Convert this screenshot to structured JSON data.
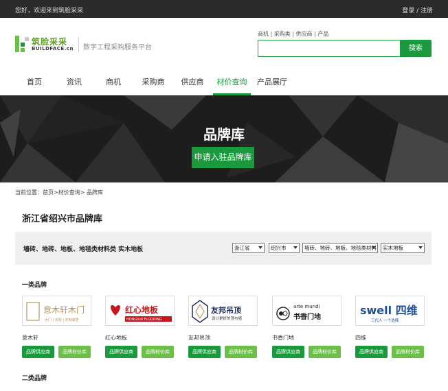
{
  "topbar": {
    "welcome": "您好，欢迎来到筑脸采采",
    "login": "登录 / 注册"
  },
  "logo": {
    "cn": "筑脸采采",
    "en": "BUILDFACE.cn",
    "slogan": "数字工程采购服务平台",
    "color": "#5a9e1e"
  },
  "search": {
    "categories": "商机 | 采购类 | 供应商 | 产品",
    "value": "",
    "button": "搜索"
  },
  "nav": {
    "items": [
      {
        "label": "首页"
      },
      {
        "label": "资讯"
      },
      {
        "label": "商机"
      },
      {
        "label": "采购商"
      },
      {
        "label": "供应商"
      },
      {
        "label": "材价查询",
        "active": true
      },
      {
        "label": "产品展厅"
      }
    ]
  },
  "hero": {
    "title": "品牌库",
    "button": "申请入驻品牌库"
  },
  "breadcrumb": "当前位置：首页>材价查询> 品牌库",
  "page_title": "浙江省绍兴市品牌库",
  "filter": {
    "label": "墙砖、地砖、地板、地毯类材料类 实木地板",
    "selects": [
      "浙江省",
      "绍兴市",
      "墙砖、地砖、地板、地毯类材料",
      "实木地板"
    ]
  },
  "sections": {
    "first": "一类品牌",
    "second": "二类品牌"
  },
  "brands": [
    {
      "name": "意木轩",
      "logo_text": "意木轩木门",
      "logo_sub": "木门 | 衣柜 | 定制家居"
    },
    {
      "name": "红心地板",
      "logo_text": "红心地板",
      "logo_sub": "HONGXIN FLOORING"
    },
    {
      "name": "友邦吊顶",
      "logo_text": "友邦吊顶",
      "logo_sub": "设计更好的顶与墙"
    },
    {
      "name": "书香门地",
      "logo_text": "书香门地",
      "logo_sub": "arte mundi"
    },
    {
      "name": "四维",
      "logo_text": "swell 四维",
      "logo_sub": "三代人 一个选择"
    }
  ],
  "brand_buttons": {
    "supplier": "品牌供应商",
    "price": "品牌材价库"
  },
  "colors": {
    "primary": "#1a9a3c",
    "secondary": "#6cc04a",
    "topbar": "#2b2b2b"
  }
}
